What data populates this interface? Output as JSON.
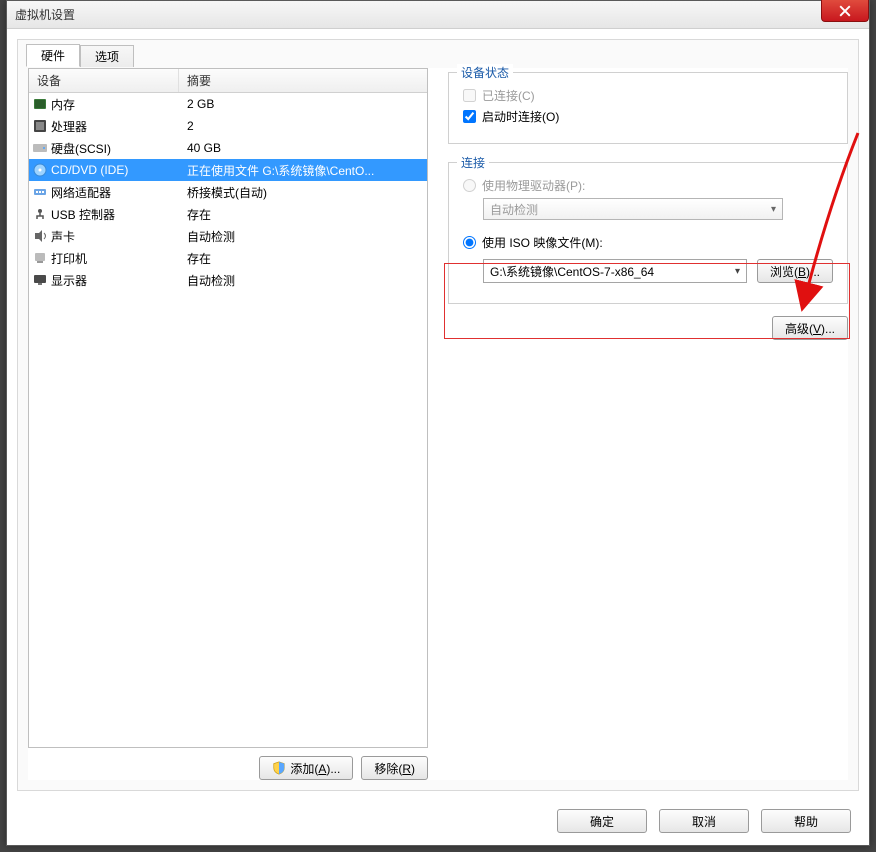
{
  "window": {
    "title": "虚拟机设置",
    "title_extra": ""
  },
  "tabs": {
    "hardware": "硬件",
    "options": "选项"
  },
  "list": {
    "col_device": "设备",
    "col_summary": "摘要",
    "rows": [
      {
        "name": "内存",
        "summary": "2 GB"
      },
      {
        "name": "处理器",
        "summary": "2"
      },
      {
        "name": "硬盘(SCSI)",
        "summary": "40 GB"
      },
      {
        "name": "CD/DVD (IDE)",
        "summary": "正在使用文件 G:\\系统镜像\\CentO..."
      },
      {
        "name": "网络适配器",
        "summary": "桥接模式(自动)"
      },
      {
        "name": "USB 控制器",
        "summary": "存在"
      },
      {
        "name": "声卡",
        "summary": "自动检测"
      },
      {
        "name": "打印机",
        "summary": "存在"
      },
      {
        "name": "显示器",
        "summary": "自动检测"
      }
    ],
    "selected_index": 3
  },
  "buttons": {
    "add": "添加(",
    "add_u": "A",
    "add_suffix": ")...",
    "remove": "移除(",
    "remove_u": "R",
    "remove_suffix": ")",
    "browse": "浏览(",
    "browse_u": "B",
    "browse_suffix": ")...",
    "advanced": "高级(",
    "advanced_u": "V",
    "advanced_suffix": ")...",
    "ok": "确定",
    "cancel": "取消",
    "help": "帮助"
  },
  "status": {
    "group": "设备状态",
    "connected_prefix": "已连接(",
    "connected_u": "C",
    "connected_suffix": ")",
    "connect_at_poweron_prefix": "启动时连接(",
    "connect_at_poweron_u": "O",
    "connect_at_poweron_suffix": ")"
  },
  "connection": {
    "group": "连接",
    "physical_prefix": "使用物理驱动器(",
    "physical_u": "P",
    "physical_suffix": "):",
    "physical_combo": "自动检测",
    "iso_prefix": "使用 ISO 映像文件(",
    "iso_u": "M",
    "iso_suffix": "):",
    "iso_path": "G:\\系统镜像\\CentOS-7-x86_64"
  }
}
